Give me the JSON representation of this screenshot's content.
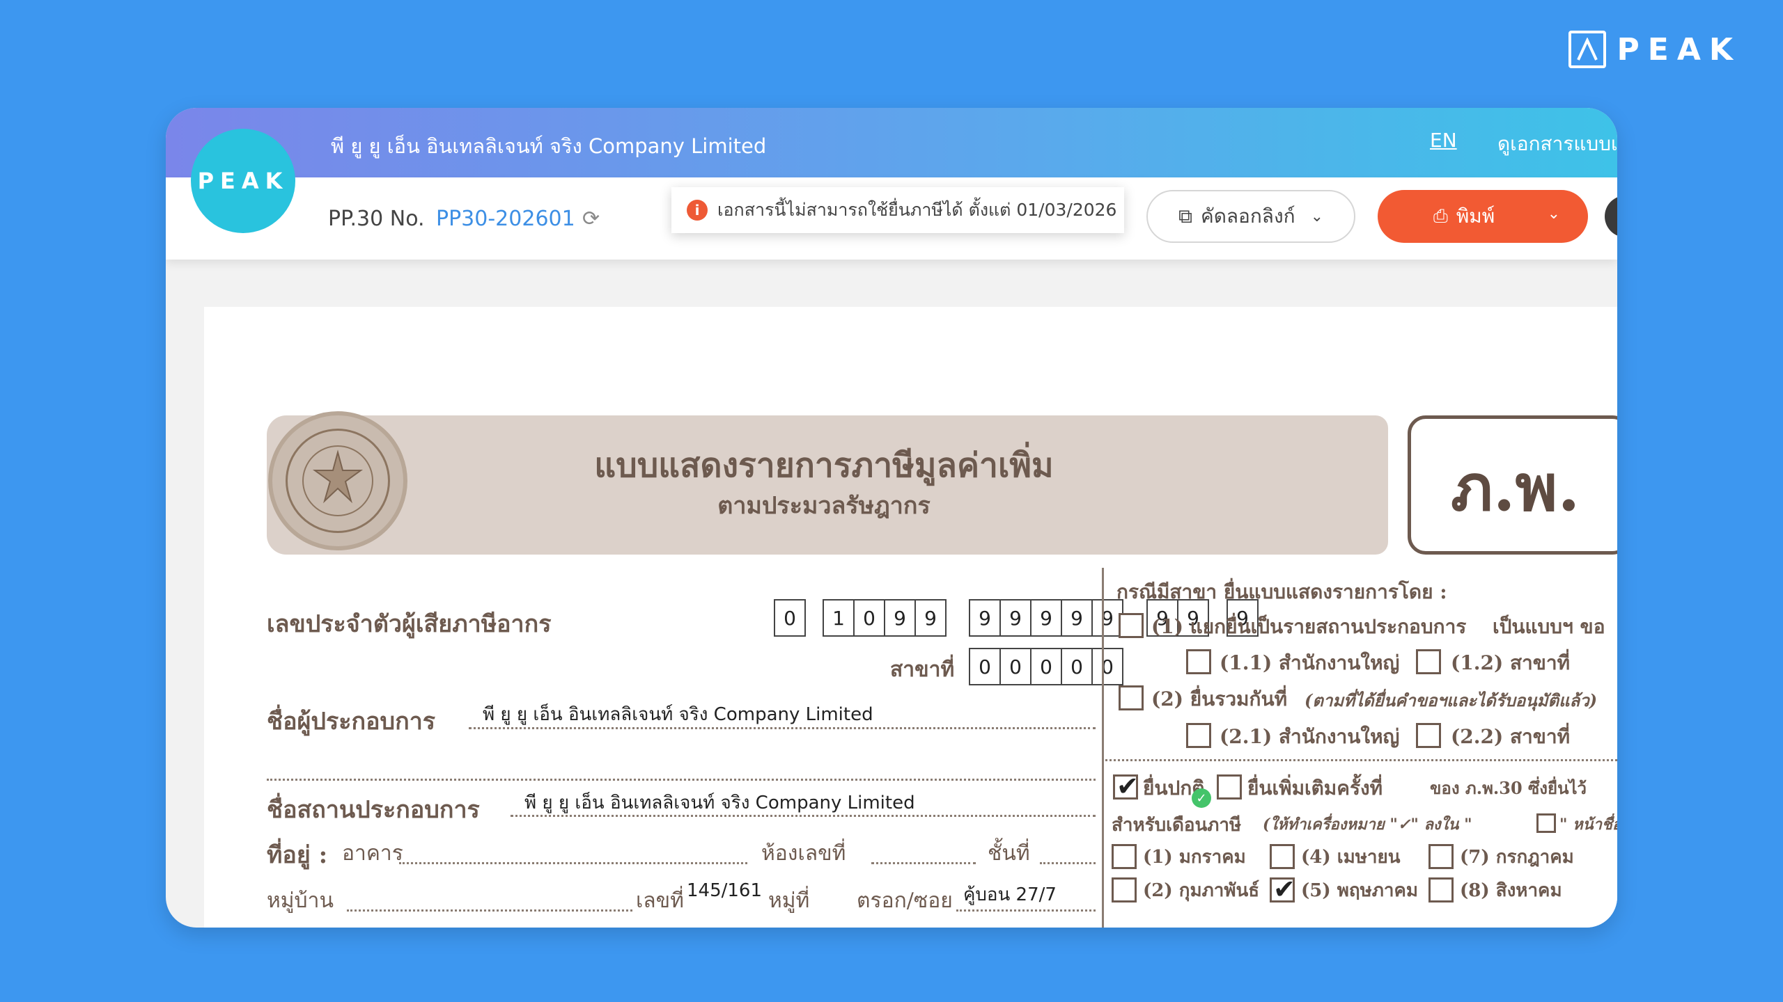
{
  "brand": {
    "wordmark": "PEAK"
  },
  "header": {
    "company_name": "พี ยู ยู เอ็น อินเทลลิเจนท์ จริง Company Limited",
    "lang": "EN",
    "original_doc_link": "ดูเอกสารแบบเดิม"
  },
  "logo": {
    "text": "PEAK"
  },
  "toolbar": {
    "doc_no_label": "PP.30 No.",
    "doc_no_value": "PP30-202601",
    "warning": "เอกสารนี้ไม่สามารถใช้ยื่นภาษีได้ ตั้งแต่ 01/03/2026",
    "copy_link_label": "คัดลอกลิงก์",
    "print_label": "พิมพ์"
  },
  "form": {
    "title": "แบบแสดงรายการภาษีมูลค่าเพิ่ม",
    "subtitle": "ตามประมวลรัษฎากร",
    "code": "ภ.พ.",
    "tax_id_label": "เลขประจำตัวผู้เสียภาษีอากร",
    "tax_id_groups": [
      [
        "0"
      ],
      [
        "1",
        "0",
        "9",
        "9"
      ],
      [
        "9",
        "9",
        "9",
        "9",
        "9"
      ],
      [
        "9",
        "9"
      ],
      [
        "9"
      ]
    ],
    "branch_label": "สาขาที่",
    "branch_digits": [
      "0",
      "0",
      "0",
      "0",
      "0"
    ],
    "operator_label": "ชื่อผู้ประกอบการ",
    "operator_value": "พี ยู ยู เอ็น อินเทลลิเจนท์ จริง Company Limited",
    "place_label": "ชื่อสถานประกอบการ",
    "place_value": "พี ยู ยู เอ็น อินเทลลิเจนท์ จริง Company Limited",
    "address_label": "ที่อยู่ :",
    "building_label": "อาคาร",
    "room_label": "ห้องเลขที่",
    "floor_label": "ชั้นที่",
    "village_label": "หมู่บ้าน",
    "number_label": "เลขที่",
    "number_value": "145/161",
    "moo_label": "หมู่ที่",
    "soi_label": "ตรอก/ซอย",
    "soi_value": "คู้บอน 27/7",
    "branch_case_title": "กรณีมีสาขา ยื่นแบบแสดงรายการโดย :",
    "opt1": "(1) แยกยื่นเป็นรายสถานประกอบการ",
    "opt1_tail": "เป็นแบบฯ ขอ",
    "opt1_1": "(1.1) สำนักงานใหญ่",
    "opt1_2": "(1.2) สาขาที่",
    "opt2": "(2) ยื่นรวมกันที่",
    "opt2_note": "(ตามที่ได้ยื่นคำขอฯและได้รับอนุมัติแล้ว)",
    "opt2_1": "(2.1) สำนักงานใหญ่",
    "opt2_2": "(2.2) สาขาที่",
    "normal_filing": "ยื่นปกติ",
    "additional_filing": "ยื่นเพิ่มเติมครั้งที่",
    "of_pp30": "ของ ภ.พ.30 ซึ่งยื่นไว้",
    "month_title": "สำหรับเดือนภาษี",
    "month_note": "(ให้ทำเครื่องหมาย \"✓\" ลงใน \"",
    "month_note_tail": "\" หน้าชื่อเดือ",
    "months": [
      "(1) มกราคม",
      "(4) เมษายน",
      "(7) กรกฎาคม",
      "(2) กุมภาพันธ์",
      "(5) พฤษภาคม",
      "(8) สิงหาคม"
    ]
  }
}
